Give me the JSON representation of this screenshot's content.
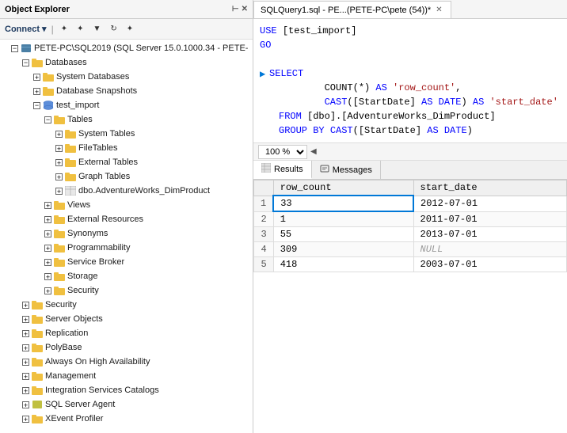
{
  "titleBar": {
    "text": "Object Explorer"
  },
  "objectExplorer": {
    "header": "Object Explorer",
    "connectBtn": "Connect ▾",
    "toolbar": {
      "icons": [
        "✦",
        "✦",
        "▼",
        "↻",
        "✦"
      ]
    },
    "tree": [
      {
        "id": "server",
        "indent": 0,
        "expand": "minus",
        "icon": "server",
        "label": "PETE-PC\\SQL2019 (SQL Server 15.0.1000.34 - PETE-"
      },
      {
        "id": "databases",
        "indent": 1,
        "expand": "minus",
        "icon": "folder",
        "label": "Databases"
      },
      {
        "id": "system-dbs",
        "indent": 2,
        "expand": "plus",
        "icon": "folder",
        "label": "System Databases"
      },
      {
        "id": "snapshots",
        "indent": 2,
        "expand": "plus",
        "icon": "folder",
        "label": "Database Snapshots"
      },
      {
        "id": "test-import",
        "indent": 2,
        "expand": "minus",
        "icon": "db",
        "label": "test_import"
      },
      {
        "id": "tables",
        "indent": 3,
        "expand": "minus",
        "icon": "folder",
        "label": "Tables"
      },
      {
        "id": "system-tables",
        "indent": 4,
        "expand": "plus",
        "icon": "folder",
        "label": "System Tables"
      },
      {
        "id": "file-tables",
        "indent": 4,
        "expand": "plus",
        "icon": "folder",
        "label": "FileTables"
      },
      {
        "id": "external-tables",
        "indent": 4,
        "expand": "plus",
        "icon": "folder",
        "label": "External Tables"
      },
      {
        "id": "graph-tables",
        "indent": 4,
        "expand": "plus",
        "icon": "folder",
        "label": "Graph Tables"
      },
      {
        "id": "dim-product",
        "indent": 4,
        "expand": "plus",
        "icon": "table",
        "label": "dbo.AdventureWorks_DimProduct"
      },
      {
        "id": "views",
        "indent": 3,
        "expand": "plus",
        "icon": "folder",
        "label": "Views"
      },
      {
        "id": "external-resources",
        "indent": 3,
        "expand": "plus",
        "icon": "folder",
        "label": "External Resources"
      },
      {
        "id": "synonyms",
        "indent": 3,
        "expand": "plus",
        "icon": "folder",
        "label": "Synonyms"
      },
      {
        "id": "programmability",
        "indent": 3,
        "expand": "plus",
        "icon": "folder",
        "label": "Programmability"
      },
      {
        "id": "service-broker",
        "indent": 3,
        "expand": "plus",
        "icon": "folder",
        "label": "Service Broker"
      },
      {
        "id": "storage",
        "indent": 3,
        "expand": "plus",
        "icon": "folder",
        "label": "Storage"
      },
      {
        "id": "security",
        "indent": 3,
        "expand": "plus",
        "icon": "folder",
        "label": "Security"
      },
      {
        "id": "security2",
        "indent": 1,
        "expand": "plus",
        "icon": "folder",
        "label": "Security"
      },
      {
        "id": "server-objects",
        "indent": 1,
        "expand": "plus",
        "icon": "folder",
        "label": "Server Objects"
      },
      {
        "id": "replication",
        "indent": 1,
        "expand": "plus",
        "icon": "folder",
        "label": "Replication"
      },
      {
        "id": "polybase",
        "indent": 1,
        "expand": "plus",
        "icon": "folder",
        "label": "PolyBase"
      },
      {
        "id": "always-on",
        "indent": 1,
        "expand": "plus",
        "icon": "folder",
        "label": "Always On High Availability"
      },
      {
        "id": "management",
        "indent": 1,
        "expand": "plus",
        "icon": "folder",
        "label": "Management"
      },
      {
        "id": "integration-services",
        "indent": 1,
        "expand": "plus",
        "icon": "folder",
        "label": "Integration Services Catalogs"
      },
      {
        "id": "sql-agent",
        "indent": 1,
        "expand": "plus",
        "icon": "agent",
        "label": "SQL Server Agent"
      },
      {
        "id": "xevent",
        "indent": 1,
        "expand": "plus",
        "icon": "folder",
        "label": "XEvent Profiler"
      }
    ]
  },
  "queryPanel": {
    "tab": {
      "label": "SQLQuery1.sql - PE...(PETE-PC\\pete (54))*",
      "modified": true
    },
    "code": {
      "lines": [
        {
          "type": "keyword",
          "text": "USE [test_import]"
        },
        {
          "type": "keyword",
          "text": "GO"
        },
        {
          "type": "blank",
          "text": ""
        },
        {
          "type": "select",
          "indicator": true,
          "parts": [
            {
              "cls": "kw-blue",
              "text": "SELECT"
            }
          ]
        },
        {
          "type": "code",
          "parts": [
            {
              "cls": "normal",
              "text": "        COUNT(*) "
            },
            {
              "cls": "kw-blue",
              "text": "AS"
            },
            {
              "cls": "normal",
              "text": " "
            },
            {
              "cls": "str-red",
              "text": "'row_count'"
            },
            {
              "cls": "normal",
              "text": ","
            }
          ]
        },
        {
          "type": "code",
          "parts": [
            {
              "cls": "normal",
              "text": "        "
            },
            {
              "cls": "kw-blue",
              "text": "CAST"
            },
            {
              "cls": "normal",
              "text": "([StartDate] "
            },
            {
              "cls": "kw-blue",
              "text": "AS DATE"
            },
            {
              "cls": "normal",
              "text": ") "
            },
            {
              "cls": "kw-blue",
              "text": "AS"
            },
            {
              "cls": "normal",
              "text": " "
            },
            {
              "cls": "str-red",
              "text": "'start_date'"
            }
          ]
        },
        {
          "type": "code",
          "parts": [
            {
              "cls": "kw-blue",
              "text": "FROM"
            },
            {
              "cls": "normal",
              "text": " [dbo].[AdventureWorks_DimProduct]"
            }
          ]
        },
        {
          "type": "code",
          "parts": [
            {
              "cls": "kw-blue",
              "text": "GROUP BY"
            },
            {
              "cls": "normal",
              "text": " "
            },
            {
              "cls": "kw-blue",
              "text": "CAST"
            },
            {
              "cls": "normal",
              "text": "([StartDate] "
            },
            {
              "cls": "kw-blue",
              "text": "AS DATE"
            },
            {
              "cls": "normal",
              "text": ")"
            }
          ]
        }
      ]
    },
    "zoom": "100 %",
    "resultsTabs": [
      {
        "id": "results",
        "label": "Results",
        "icon": "grid",
        "active": true
      },
      {
        "id": "messages",
        "label": "Messages",
        "icon": "msg",
        "active": false
      }
    ],
    "resultsTable": {
      "columns": [
        "",
        "row_count",
        "start_date"
      ],
      "rows": [
        {
          "rowNum": "1",
          "row_count": "33",
          "start_date": "2012-07-01",
          "selected": true
        },
        {
          "rowNum": "2",
          "row_count": "1",
          "start_date": "2011-07-01"
        },
        {
          "rowNum": "3",
          "row_count": "55",
          "start_date": "2013-07-01"
        },
        {
          "rowNum": "4",
          "row_count": "309",
          "start_date": "NULL"
        },
        {
          "rowNum": "5",
          "row_count": "418",
          "start_date": "2003-07-01"
        }
      ]
    }
  }
}
